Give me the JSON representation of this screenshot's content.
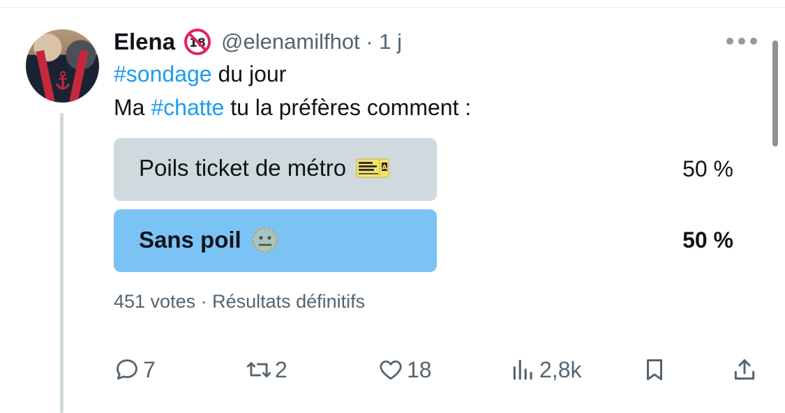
{
  "tweet": {
    "author_name": "Elena",
    "handle_line": "@elenamilfhot · 1 j",
    "text_line1_hashtag": "#sondage",
    "text_line1_rest": " du jour",
    "text_line2_prefix": "Ma ",
    "text_line2_hashtag": "#chatte",
    "text_line2_rest": " tu la préfères comment :"
  },
  "poll": {
    "options": [
      {
        "label": "Poils ticket de métro",
        "percent_text": "50 %",
        "percent": 50,
        "emoji": "ticket-icon",
        "winner": false
      },
      {
        "label": "Sans poil",
        "percent_text": "50 %",
        "percent": 50,
        "emoji": "neutral-face-icon",
        "winner": true
      }
    ],
    "meta": "451 votes · Résultats définitifs"
  },
  "actions": {
    "reply": {
      "icon": "reply-icon",
      "count": "7"
    },
    "retweet": {
      "icon": "retweet-icon",
      "count": "2"
    },
    "like": {
      "icon": "heart-icon",
      "count": "18"
    },
    "views": {
      "icon": "views-icon",
      "count": "2,8k"
    },
    "bookmark": {
      "icon": "bookmark-icon"
    },
    "share": {
      "icon": "share-icon"
    }
  },
  "colors": {
    "link": "#1d9bf0",
    "secondary_text": "#536471",
    "poll_bar_default": "#cfd9de",
    "poll_bar_selected": "#7cc3f5"
  }
}
